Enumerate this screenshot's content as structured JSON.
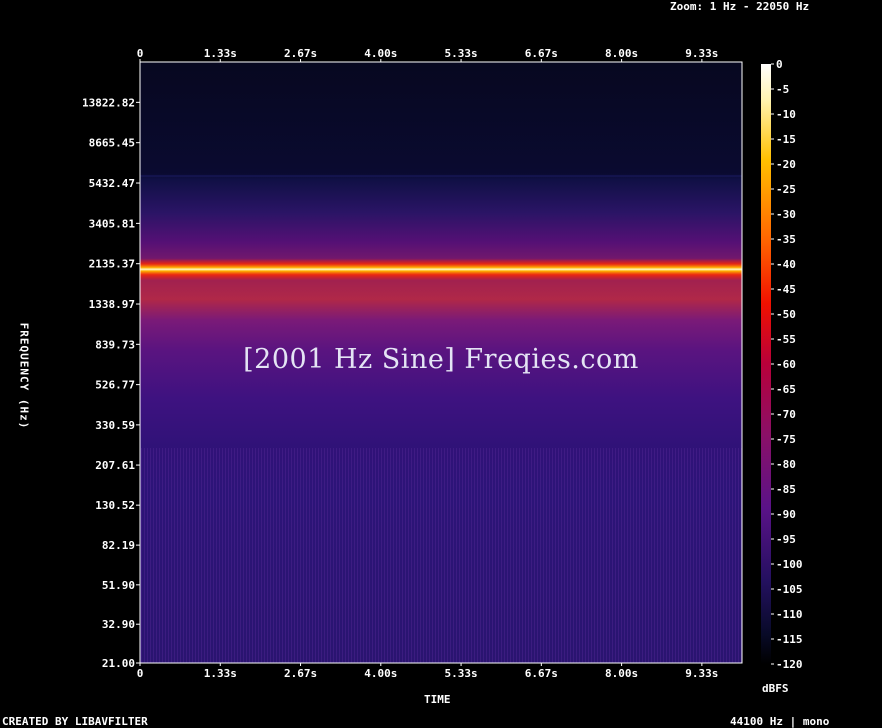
{
  "header": {
    "zoom_text": "Zoom: 1 Hz - 22050 Hz"
  },
  "footer": {
    "created_by": "CREATED BY LIBAVFILTER",
    "sample_info": "44100 Hz | mono"
  },
  "watermark": "[2001 Hz Sine] Freqies.com",
  "colors": {
    "background": "#000000",
    "axis": "#ffffff",
    "tone_core": "#fff8c8",
    "tone_glow": "#ff2a00",
    "low_noise": "#2a1470",
    "high_band": "#080a2a"
  },
  "chart_data": {
    "type": "heatmap",
    "title": "",
    "xlabel": "TIME",
    "ylabel": "FREQUENCY (Hz)",
    "x_ticks": [
      "0",
      "1.33s",
      "2.67s",
      "4.00s",
      "5.33s",
      "6.67s",
      "8.00s",
      "9.33s"
    ],
    "y_ticks": [
      "21.00",
      "32.90",
      "51.90",
      "82.19",
      "130.52",
      "207.61",
      "330.59",
      "526.77",
      "839.73",
      "1338.97",
      "2135.37",
      "3405.81",
      "5432.47",
      "8665.45",
      "13822.82"
    ],
    "y_scale": "log",
    "y_range_hz": [
      21,
      22050
    ],
    "x_range_s": [
      0,
      10
    ],
    "signal": {
      "frequency_hz": 2001,
      "level_dbfs": 0
    },
    "colorbar": {
      "label": "dBFS",
      "ticks": [
        "0",
        "-5",
        "-10",
        "-15",
        "-20",
        "-25",
        "-30",
        "-35",
        "-40",
        "-45",
        "-50",
        "-55",
        "-60",
        "-65",
        "-70",
        "-75",
        "-80",
        "-85",
        "-90",
        "-95",
        "-100",
        "-105",
        "-110",
        "-115",
        "-120"
      ],
      "range_dbfs": [
        -120,
        0
      ]
    }
  }
}
